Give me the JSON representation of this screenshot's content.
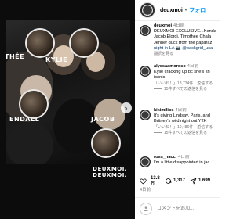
{
  "photo": {
    "labels": {
      "thee": "THÉE",
      "kylie": "KYLIE",
      "kendall": "ENDALL",
      "jacob": "JACOB"
    },
    "watermark": [
      "DEUXMOI.",
      "DEUXMOI."
    ]
  },
  "header": {
    "username": "deuxmoi",
    "follow_label": "フォロ"
  },
  "comments": [
    {
      "username": "deuxmoi",
      "time": "4日前",
      "lines": [
        "DEUXMOI EXCLUSIVE...Kenda",
        "Jacob Elordi, Timothée Chala",
        "Jenner duck from the paparaz",
        "night in LA 📷 @backgrid_usa"
      ],
      "meta": "翻訳を見る"
    },
    {
      "username": "alyssaamoroso",
      "time": "4日前",
      "lines": [
        "Kylie cracking up bc she's kn",
        "iconic"
      ],
      "meta": "「いいね！」18,734件　返信する",
      "replies": "15件すべての返信を見る"
    },
    {
      "username": "kikimilios",
      "time": "4日前",
      "lines": [
        "It's giving Lindsay, Paris, and",
        "Britney's wild night out Y2K"
      ],
      "meta": "「いいね！」10,486件　返信する",
      "replies": "15件すべての返信を見る"
    },
    {
      "username": "ross_nacci",
      "time": "4日前",
      "lines": [
        "I'm a little disappointed in jac"
      ]
    }
  ],
  "actions": {
    "likes": "13.8",
    "likes_unit": "万",
    "comments": "1,317",
    "shares": "1,699"
  },
  "stats": {
    "time": "4日前"
  },
  "comment_bar": {
    "placeholder": "コメントを追加..."
  }
}
